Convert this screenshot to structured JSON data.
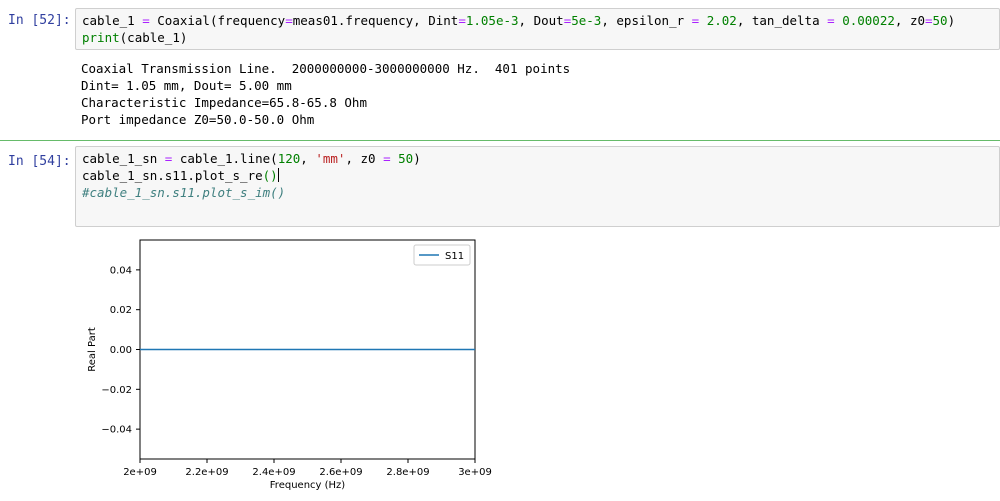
{
  "cells": [
    {
      "prompt": "In [52]:",
      "code_lines": [
        [
          {
            "t": "cable_1 ",
            "c": "fn"
          },
          {
            "t": "=",
            "c": "kw-eq"
          },
          {
            "t": " Coaxial(frequency",
            "c": "fn"
          },
          {
            "t": "=",
            "c": "kw-eq"
          },
          {
            "t": "meas01.frequency, Dint",
            "c": "fn"
          },
          {
            "t": "=",
            "c": "kw-eq"
          },
          {
            "t": "1.05e-3",
            "c": "num"
          },
          {
            "t": ", Dout",
            "c": "fn"
          },
          {
            "t": "=",
            "c": "kw-eq"
          },
          {
            "t": "5e-3",
            "c": "num"
          },
          {
            "t": ", epsilon_r ",
            "c": "fn"
          },
          {
            "t": "=",
            "c": "kw-eq"
          },
          {
            "t": " ",
            "c": "fn"
          },
          {
            "t": "2.02",
            "c": "num"
          },
          {
            "t": ", tan_delta ",
            "c": "fn"
          },
          {
            "t": "=",
            "c": "kw-eq"
          },
          {
            "t": " ",
            "c": "fn"
          },
          {
            "t": "0.00022",
            "c": "num"
          },
          {
            "t": ", z0",
            "c": "fn"
          },
          {
            "t": "=",
            "c": "kw-eq"
          },
          {
            "t": "50",
            "c": "num"
          },
          {
            "t": ")",
            "c": "fn"
          }
        ],
        [
          {
            "t": "print",
            "c": "num"
          },
          {
            "t": "(cable_1)",
            "c": "fn"
          }
        ]
      ],
      "output_lines": [
        "Coaxial Transmission Line.  2000000000-3000000000 Hz.  401 points",
        "Dint= 1.05 mm, Dout= 5.00 mm",
        "Characteristic Impedance=65.8-65.8 Ohm",
        "Port impedance Z0=50.0-50.0 Ohm"
      ]
    },
    {
      "prompt": "In [54]:",
      "code_lines": [
        [
          {
            "t": "cable_1_sn ",
            "c": "fn"
          },
          {
            "t": "=",
            "c": "kw-eq"
          },
          {
            "t": " cable_1.line(",
            "c": "fn"
          },
          {
            "t": "120",
            "c": "num"
          },
          {
            "t": ", ",
            "c": "fn"
          },
          {
            "t": "'mm'",
            "c": "str"
          },
          {
            "t": ", z0 ",
            "c": "fn"
          },
          {
            "t": "=",
            "c": "kw-eq"
          },
          {
            "t": " ",
            "c": "fn"
          },
          {
            "t": "50",
            "c": "num"
          },
          {
            "t": ")",
            "c": "fn"
          }
        ],
        [
          {
            "t": "cable_1_sn.s11.plot_s_re",
            "c": "fn"
          },
          {
            "t": "()",
            "c": "num"
          }
        ],
        [
          {
            "t": "#cable_1_sn.s11.plot_s_im()",
            "c": "comment"
          }
        ]
      ]
    }
  ],
  "chart_data": {
    "type": "line",
    "xlabel": "Frequency (Hz)",
    "ylabel": "Real Part",
    "xlim": [
      2000000000,
      3000000000
    ],
    "ylim": [
      -0.055,
      0.055
    ],
    "x_ticks": [
      2000000000,
      2200000000,
      2400000000,
      2600000000,
      2800000000,
      3000000000
    ],
    "x_tick_labels": [
      "2e+09",
      "2.2e+09",
      "2.4e+09",
      "2.6e+09",
      "2.8e+09",
      "3e+09"
    ],
    "y_ticks": [
      0.04,
      0.02,
      0.0,
      -0.02,
      -0.04
    ],
    "y_tick_labels": [
      "0.04",
      "0.02",
      "0.00",
      "−0.02",
      "−0.04"
    ],
    "legend_location": "top-right",
    "series": [
      {
        "name": "S11",
        "color": "#1f77b4",
        "x": [
          2000000000,
          3000000000
        ],
        "y": [
          0.0,
          0.0
        ]
      }
    ]
  }
}
